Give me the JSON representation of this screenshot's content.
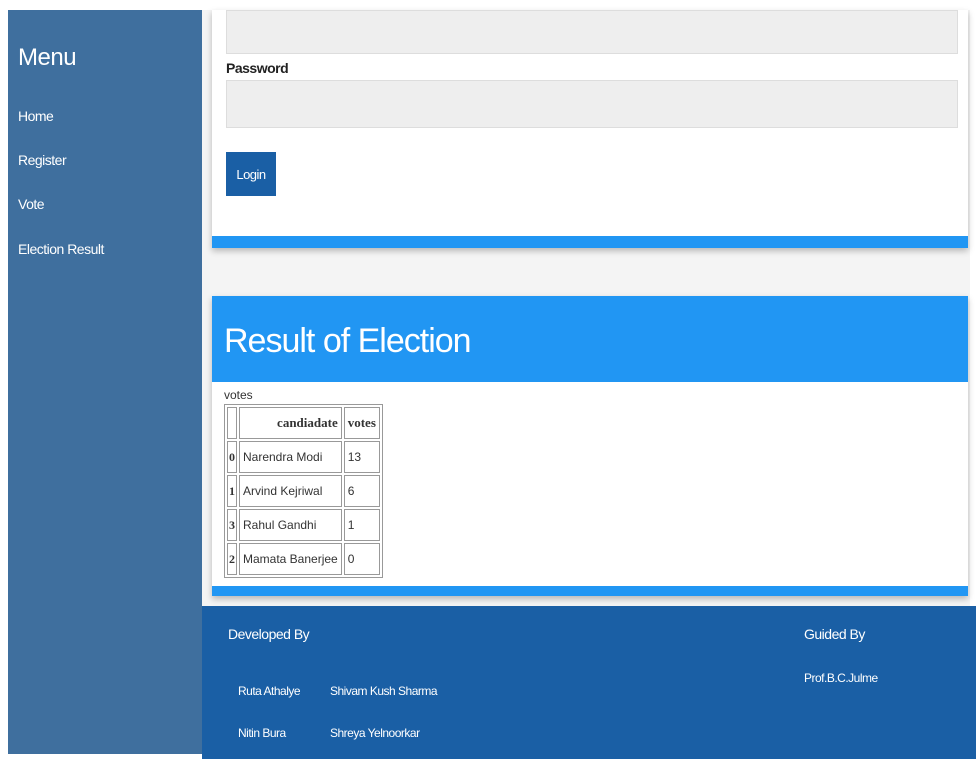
{
  "sidebar": {
    "title": "Menu",
    "items": [
      {
        "label": "Home"
      },
      {
        "label": "Register"
      },
      {
        "label": "Vote"
      },
      {
        "label": "Election Result"
      }
    ]
  },
  "login": {
    "password_label": "Password",
    "password_value": "",
    "button_label": "Login"
  },
  "result": {
    "title": "Result of Election",
    "caption": "votes",
    "columns": [
      "",
      "candiadate",
      "votes"
    ],
    "rows": [
      {
        "index": "0",
        "candidate": "Narendra Modi",
        "votes": "13"
      },
      {
        "index": "1",
        "candidate": "Arvind Kejriwal",
        "votes": "6"
      },
      {
        "index": "3",
        "candidate": "Rahul Gandhi",
        "votes": "1"
      },
      {
        "index": "2",
        "candidate": "Mamata Banerjee",
        "votes": "0"
      }
    ]
  },
  "footer": {
    "developed_by_label": "Developed By",
    "developers": [
      "Ruta Athalye",
      "Shivam Kush Sharma",
      "Nitin Bura",
      "Shreya Yelnoorkar"
    ],
    "guided_by_label": "Guided By",
    "guide": "Prof.B.C.Julme"
  },
  "colors": {
    "sidebar": "#3f6f9e",
    "accent": "#2196f3",
    "primary_button": "#1a5fa5",
    "footer": "#1a5fa5"
  }
}
